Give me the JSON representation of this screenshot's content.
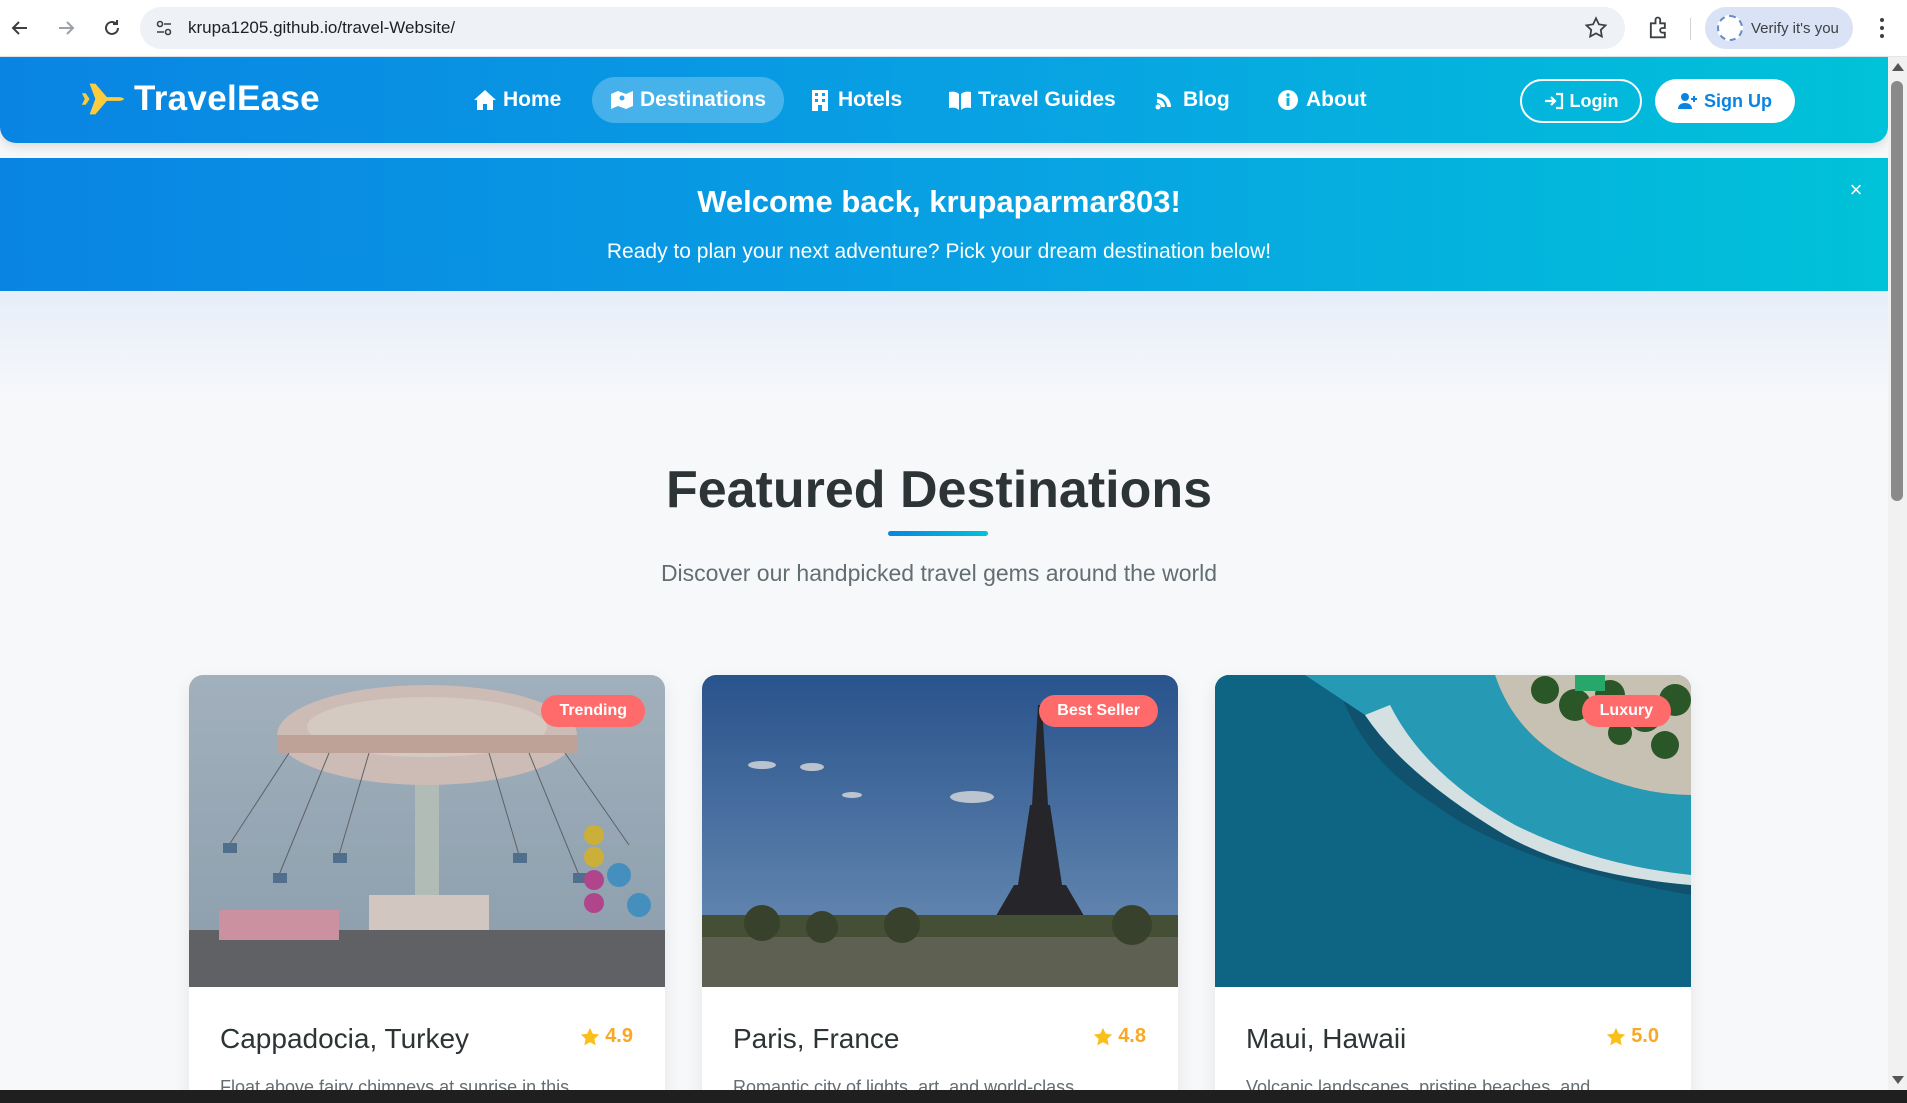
{
  "browser": {
    "url": "krupa1205.github.io/travel-Website/",
    "profile_label": "Verify it's you"
  },
  "header": {
    "brand": "TravelEase",
    "nav": [
      {
        "label": "Home",
        "icon": "home-icon",
        "active": false
      },
      {
        "label": "Destinations",
        "icon": "map-icon",
        "active": true
      },
      {
        "label": "Hotels",
        "icon": "hotel-icon",
        "active": false
      },
      {
        "label": "Travel Guides",
        "icon": "book-icon",
        "active": false
      },
      {
        "label": "Blog",
        "icon": "blog-icon",
        "active": false
      },
      {
        "label": "About",
        "icon": "info-icon",
        "active": false
      }
    ],
    "login_label": "Login",
    "signup_label": "Sign Up"
  },
  "welcome": {
    "title": "Welcome back, krupaparmar803!",
    "message": "Ready to plan your next adventure? Pick your dream destination below!",
    "close_label": "×"
  },
  "featured": {
    "title": "Featured Destinations",
    "subtitle": "Discover our handpicked travel gems around the world",
    "cards": [
      {
        "badge": "Trending",
        "title": "Cappadocia, Turkey",
        "rating": "4.9",
        "description": "Float above fairy chimneys at sunrise in this"
      },
      {
        "badge": "Best Seller",
        "title": "Paris, France",
        "rating": "4.8",
        "description": "Romantic city of lights, art, and world-class"
      },
      {
        "badge": "Luxury",
        "title": "Maui, Hawaii",
        "rating": "5.0",
        "description": "Volcanic landscapes, pristine beaches, and"
      }
    ]
  },
  "colors": {
    "primary": "#0984e3",
    "accent": "#00c2d8",
    "badge": "#ff6b6b",
    "star": "#f9a825"
  }
}
